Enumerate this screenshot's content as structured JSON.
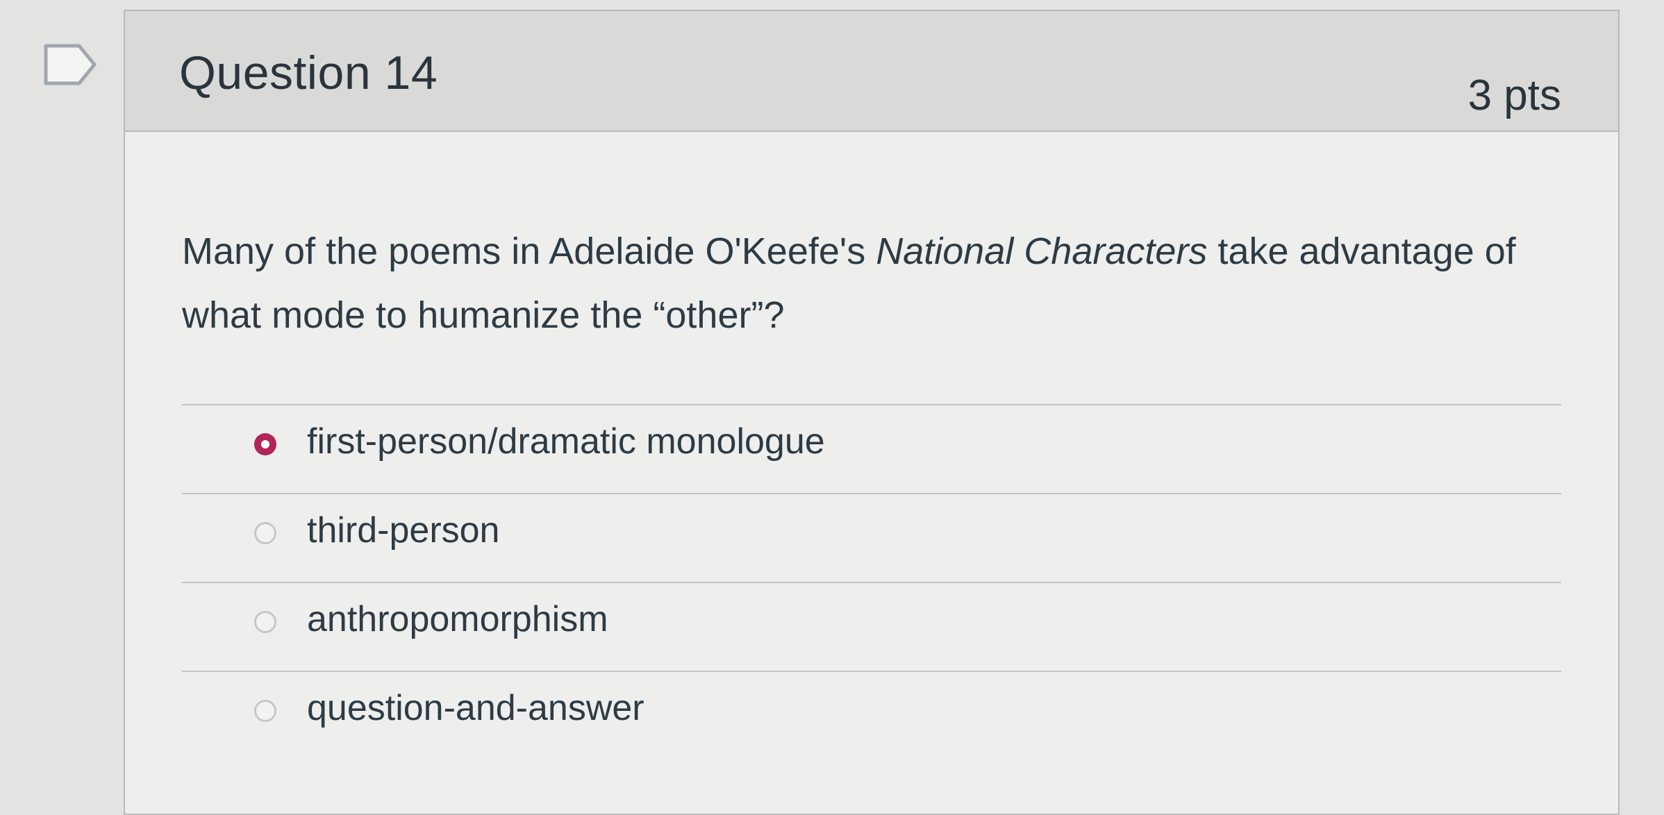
{
  "question": {
    "title": "Question 14",
    "points": "3 pts",
    "text_part1": "Many of the poems in Adelaide O'Keefe's ",
    "text_italic": "National Characters",
    "text_part2": " take advantage of what mode to humanize the “other”?"
  },
  "answers": [
    {
      "label": "first-person/dramatic monologue",
      "selected": true
    },
    {
      "label": "third-person",
      "selected": false
    },
    {
      "label": "anthropomorphism",
      "selected": false
    },
    {
      "label": "question-and-answer",
      "selected": false
    }
  ],
  "colors": {
    "selected_radio": "#b3245a",
    "header_bg": "#d9dad8",
    "card_bg": "#eeeeec",
    "text": "#2d3b45"
  },
  "icons": {
    "flag": "bookmark-flag-icon"
  }
}
